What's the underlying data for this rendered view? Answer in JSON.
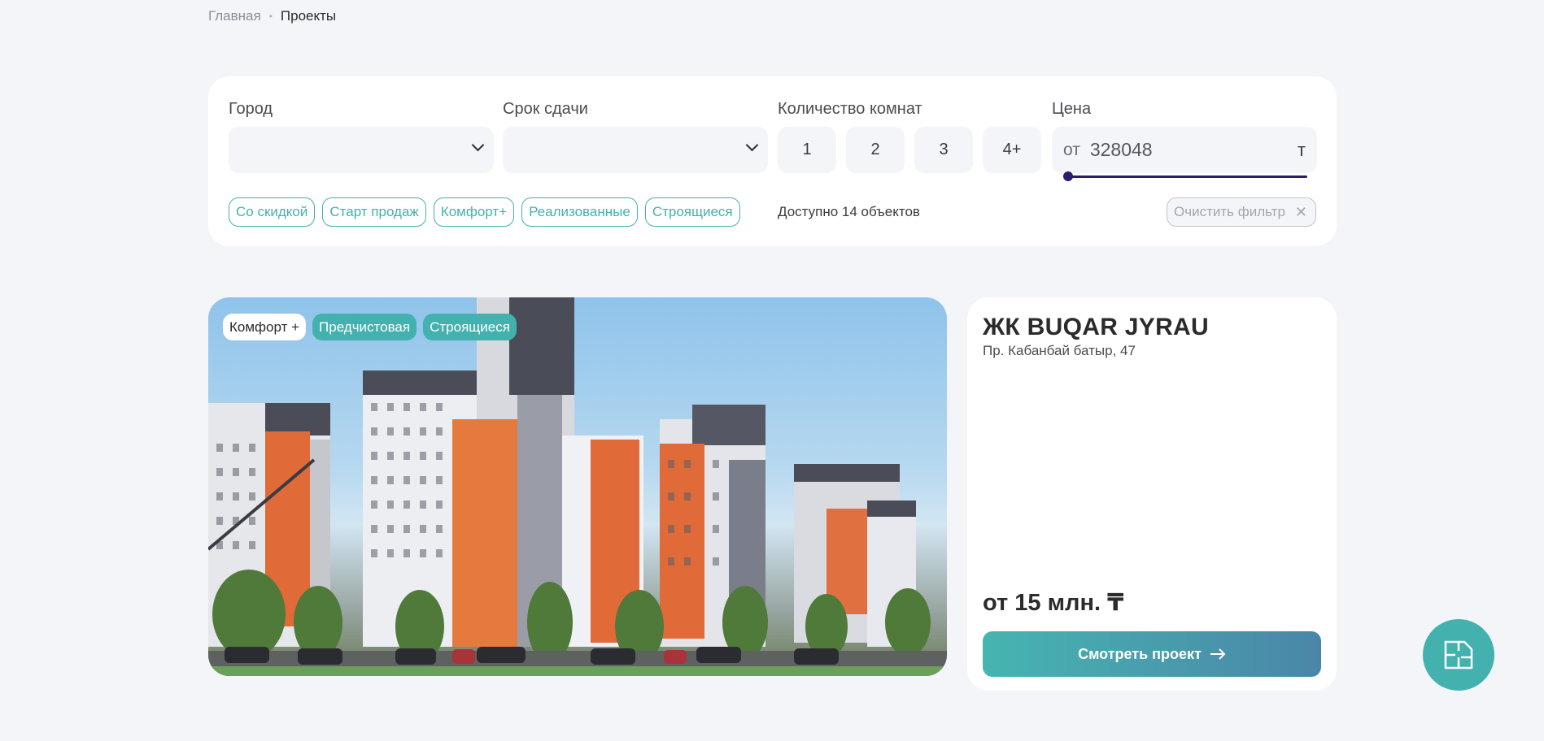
{
  "breadcrumb": {
    "home": "Главная",
    "separator": "•",
    "current": "Проекты"
  },
  "filters": {
    "city": {
      "label": "Город",
      "value": ""
    },
    "deadline": {
      "label": "Срок сдачи",
      "value": ""
    },
    "rooms": {
      "label": "Количество комнат",
      "options": [
        "1",
        "2",
        "3",
        "4+"
      ]
    },
    "price": {
      "label": "Цена",
      "from_label": "от",
      "value": "328048",
      "currency": "т",
      "slider_fraction": 0.0
    },
    "tags": [
      "Со скидкой",
      "Старт продаж",
      "Комфорт+",
      "Реализованные",
      "Строящиеся"
    ],
    "available_text": "Доступно 14 объектов",
    "clear_label": "Очистить фильтр",
    "clear_icon": "close-icon"
  },
  "project": {
    "badges": [
      "Комфорт +",
      "Предчистовая",
      "Строящиеся"
    ],
    "title": "ЖК BUQAR JYRAU",
    "address": "Пр. Кабанбай батыр, 47",
    "price": "от 15 млн. ₸",
    "button_label": "Смотреть проект",
    "button_icon": "arrow-right-icon"
  },
  "fab": {
    "icon": "floor-plan-icon"
  },
  "colors": {
    "accent": "#43b1ae",
    "slider": "#2d1b6b",
    "background": "#f4f5f9"
  }
}
